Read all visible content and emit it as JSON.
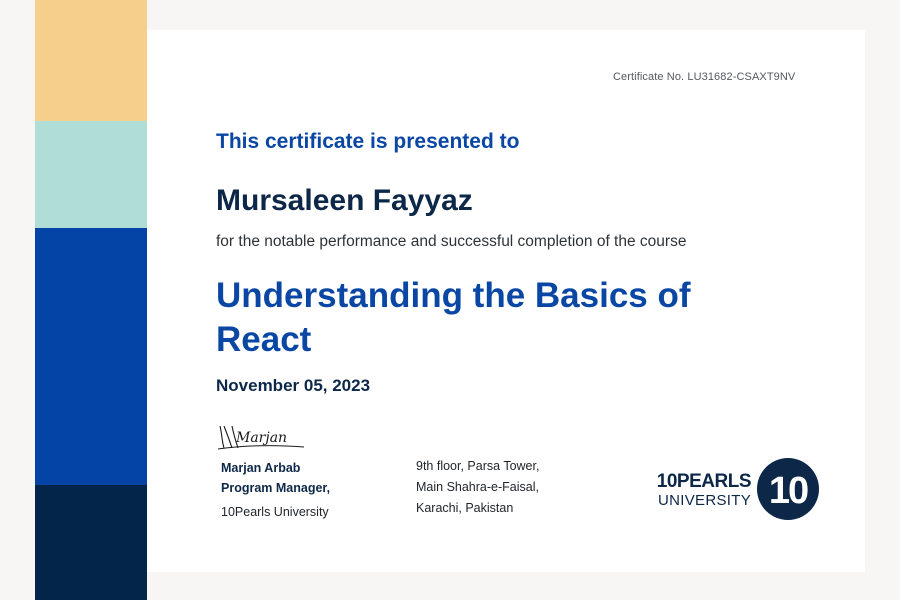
{
  "palette": {
    "stripes": [
      "#f6cf8c",
      "#b0ded6",
      "#0344a6",
      "#022549"
    ],
    "accent_blue": "#0a47a4",
    "navy": "#0d2748"
  },
  "certificate": {
    "number_text": "Certificate No. LU31682-CSAXT9NV",
    "presented_to": "This certificate is presented to",
    "recipient_name": "Mursaleen Fayyaz",
    "statement": "for the notable performance and successful completion of the course",
    "course_title": "Understanding the Basics of React",
    "date": "November 05, 2023"
  },
  "signatory": {
    "signature_text": "Marjan",
    "name": "Marjan Arbab",
    "title": "Program Manager,",
    "organization": "10Pearls University"
  },
  "address": {
    "line1": "9th floor, Parsa Tower,",
    "line2": "Main Shahra-e-Faisal,",
    "line3": "Karachi, Pakistan"
  },
  "logo": {
    "brand": "10PEARLS",
    "sub": "UNIVERSITY",
    "mark_text": "10"
  }
}
